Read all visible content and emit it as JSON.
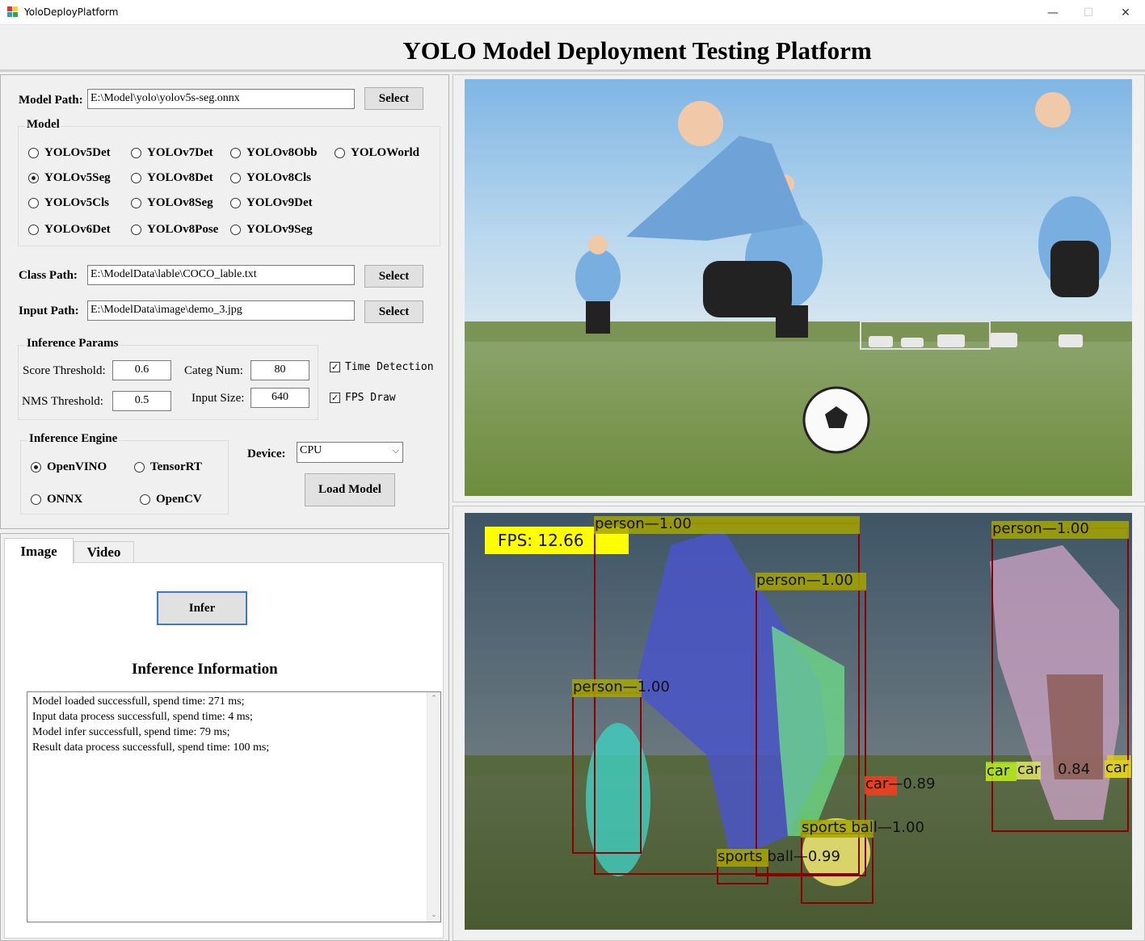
{
  "window": {
    "title": "YoloDeployPlatform",
    "minimize": "—",
    "maximize": "☐",
    "close": "✕"
  },
  "app_title": "YOLO Model Deployment Testing Platform",
  "model_path": {
    "label": "Model Path:",
    "value": "E:\\Model\\yolo\\yolov5s-seg.onnx",
    "button": "Select"
  },
  "model_group": {
    "title": "Model",
    "selected": "YOLOv5Seg",
    "options": [
      "YOLOv5Det",
      "YOLOv7Det",
      "YOLOv8Obb",
      "YOLOWorld",
      "YOLOv5Seg",
      "YOLOv8Det",
      "YOLOv8Cls",
      "YOLOv5Cls",
      "YOLOv8Seg",
      "YOLOv9Det",
      "YOLOv6Det",
      "YOLOv8Pose",
      "YOLOv9Seg"
    ]
  },
  "class_path": {
    "label": "Class Path:",
    "value": "E:\\ModelData\\lable\\COCO_lable.txt",
    "button": "Select"
  },
  "input_path": {
    "label": "Input Path:",
    "value": "E:\\ModelData\\image\\demo_3.jpg",
    "button": "Select"
  },
  "inference_params": {
    "title": "Inference Params",
    "score_label": "Score Threshold:",
    "score_value": "0.6",
    "nms_label": "NMS Threshold:",
    "nms_value": "0.5",
    "categ_label": "Categ Num:",
    "categ_value": "80",
    "size_label": "Input Size:",
    "size_value": "640"
  },
  "options": {
    "time_detection": "Time Detection",
    "time_detection_checked": true,
    "fps_draw": "FPS Draw",
    "fps_draw_checked": true
  },
  "engine_group": {
    "title": "Inference Engine",
    "selected": "OpenVINO",
    "options": [
      "OpenVINO",
      "TensorRT",
      "ONNX",
      "OpenCV"
    ]
  },
  "device": {
    "label": "Device:",
    "value": "CPU"
  },
  "load_model_button": "Load Model",
  "tabs": {
    "image": "Image",
    "video": "Video",
    "active": "Image"
  },
  "infer_button": "Infer",
  "info_title": "Inference Information",
  "log": [
    "Model loaded successfull, spend time: 271 ms;",
    "Input data process successfull, spend time: 4 ms;",
    "Model infer successfull, spend time: 79 ms;",
    "Result data process successfull, spend time: 100 ms;"
  ],
  "result": {
    "fps_text": "FPS: 12.66",
    "detections": [
      "person—1.00",
      "person—1.00",
      "person—1.00",
      "person—1.00",
      "car—0.89",
      "car",
      "car",
      "0.84",
      "car",
      "sports ball—1.00",
      "sports ball—0.99"
    ]
  },
  "colors": {
    "box": "#8b0000",
    "label_olive": "#a6a600",
    "fps_bg": "#ffff00",
    "sky_top": "#8fbfe3",
    "grass": "#6c8a3a"
  }
}
